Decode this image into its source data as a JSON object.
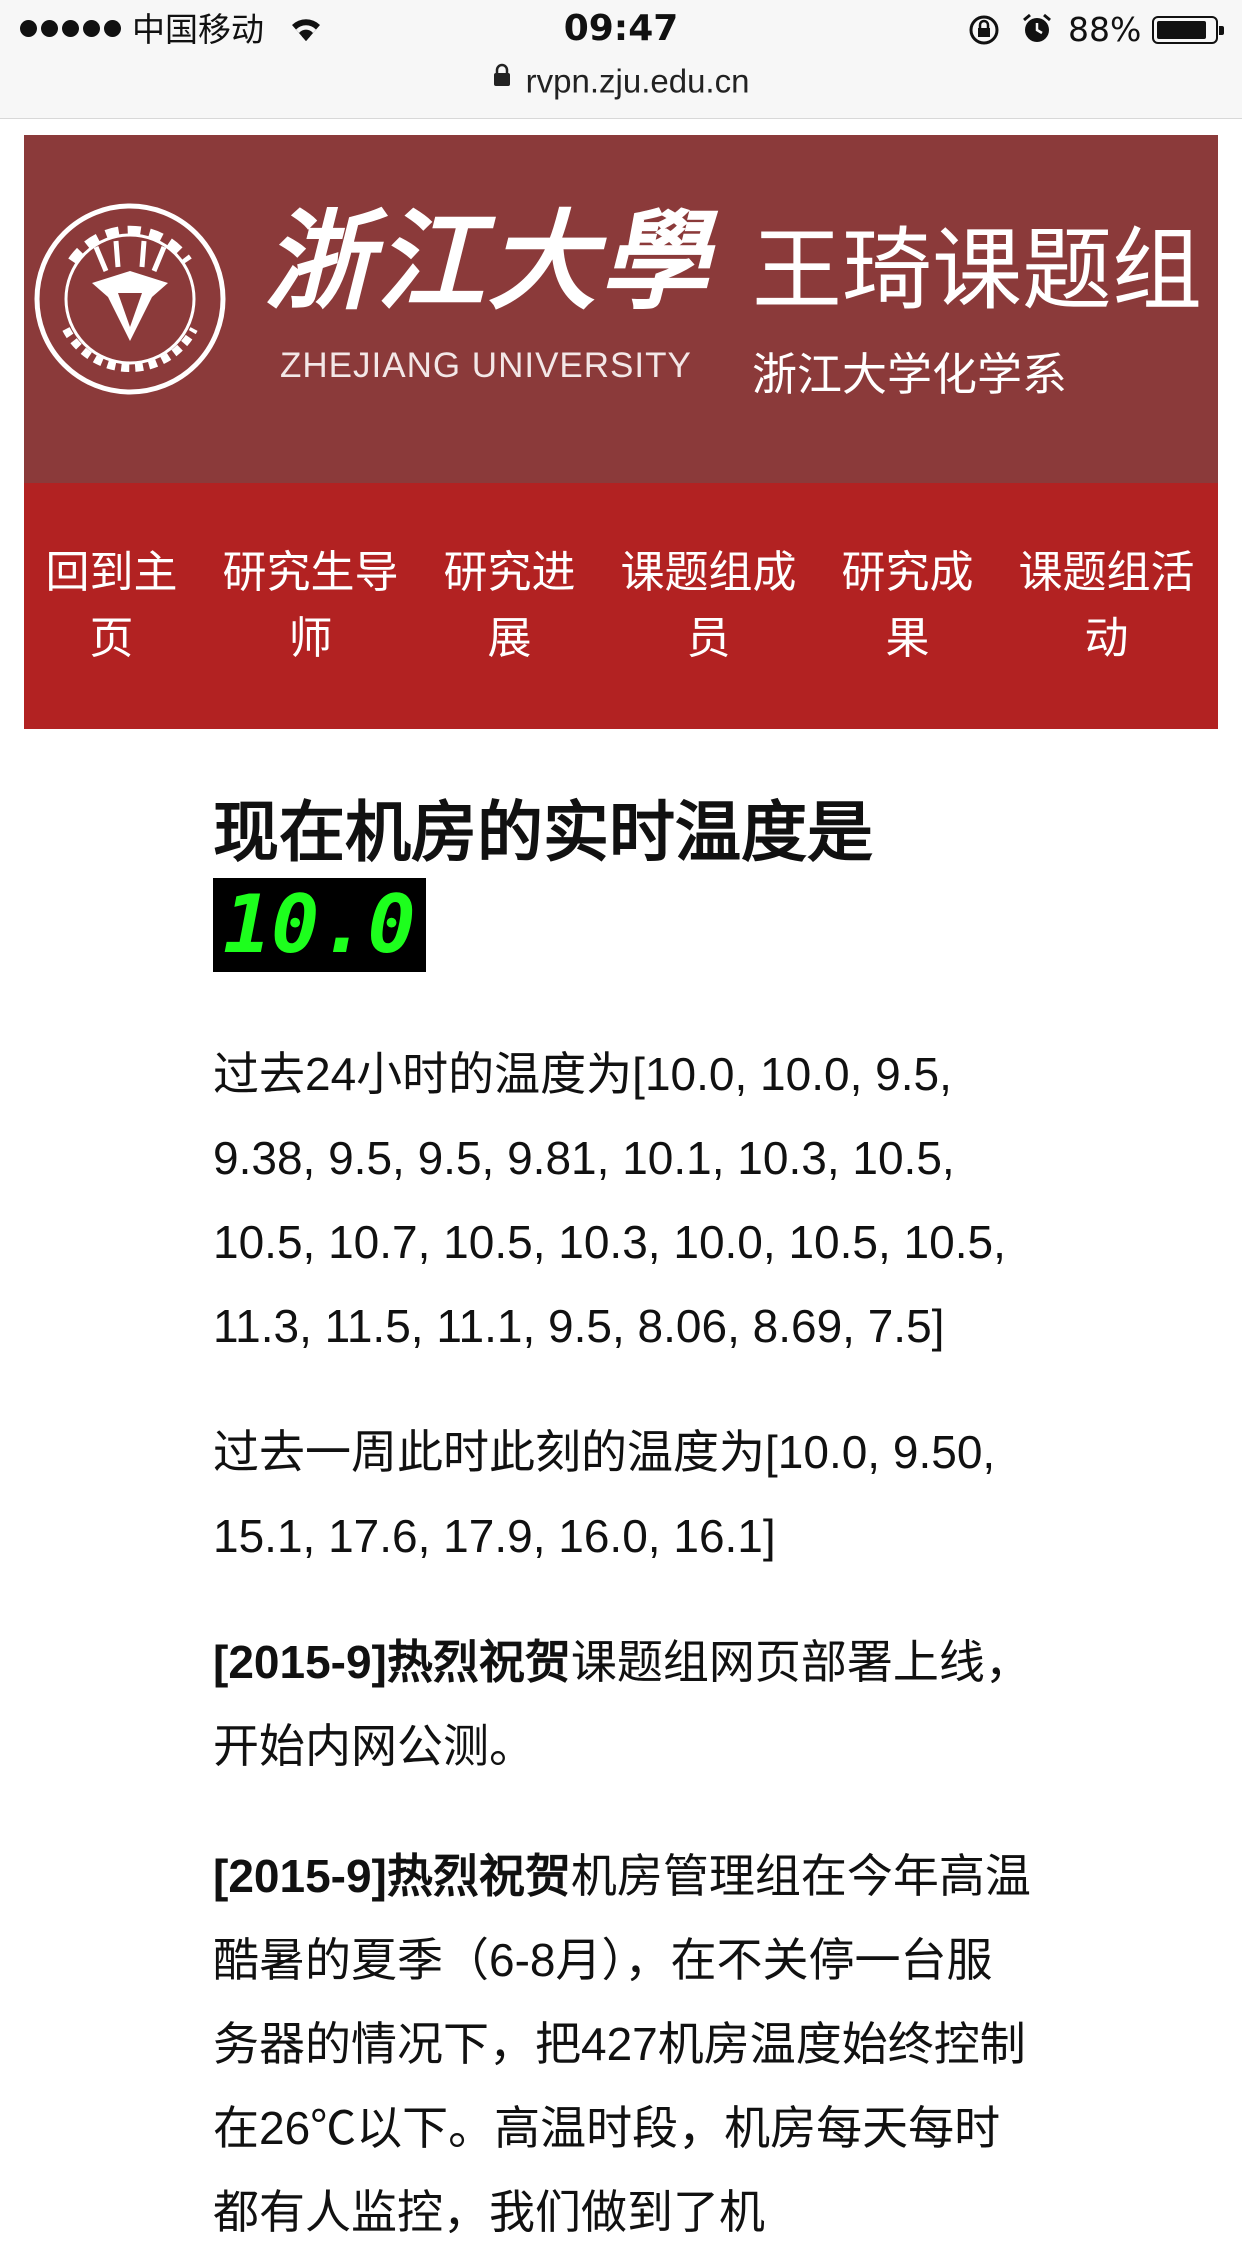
{
  "status_bar": {
    "carrier": "中国移动",
    "time": "09:47",
    "battery_percent": "88%",
    "battery_level": 0.88,
    "signal_bars": 5
  },
  "url_bar": {
    "url": "rvpn.zju.edu.cn"
  },
  "banner": {
    "university_name_cn": "浙江大學",
    "university_name_en": "ZHEJIANG UNIVERSITY",
    "group_title": "王琦课题组",
    "department": "浙江大学化学系",
    "seal_icon": "zju-seal-icon"
  },
  "nav": {
    "items": [
      {
        "label": "回到主页"
      },
      {
        "label": "研究生导师"
      },
      {
        "label": "研究进展"
      },
      {
        "label": "课题组成员"
      },
      {
        "label": "研究成果"
      },
      {
        "label": "课题组活动"
      }
    ]
  },
  "content": {
    "headline_prefix": "现在机房的实时温度是",
    "current_temperature": "10.0",
    "past_24h_label": "过去24小时的温度为",
    "past_24h_values": "[10.0, 10.0, 9.5, 9.38, 9.5, 9.5, 9.81, 10.1, 10.3, 10.5, 10.5, 10.7, 10.5, 10.3, 10.0, 10.5, 10.5, 11.3, 11.5, 11.1, 9.5, 8.06, 8.69, 7.5]",
    "past_week_label": "过去一周此时此刻的温度为",
    "past_week_values": "[10.0, 9.50, 15.1, 17.6, 17.9, 16.0, 16.1]",
    "news": [
      {
        "date_tag": "[2015-9]热烈祝贺",
        "text": "课题组网页部署上线，开始内网公测。"
      },
      {
        "date_tag": "[2015-9]热烈祝贺",
        "text": "机房管理组在今年高温酷暑的夏季（6-8月），在不关停一台服务器的情况下，把427机房温度始终控制在26℃以下。高温时段，机房每天每时都有人监控，我们做到了机"
      }
    ]
  },
  "colors": {
    "banner_bg": "#8b3a3a",
    "nav_bg": "#b22222",
    "lcd_bg": "#000000",
    "lcd_fg": "#1dff1d"
  }
}
